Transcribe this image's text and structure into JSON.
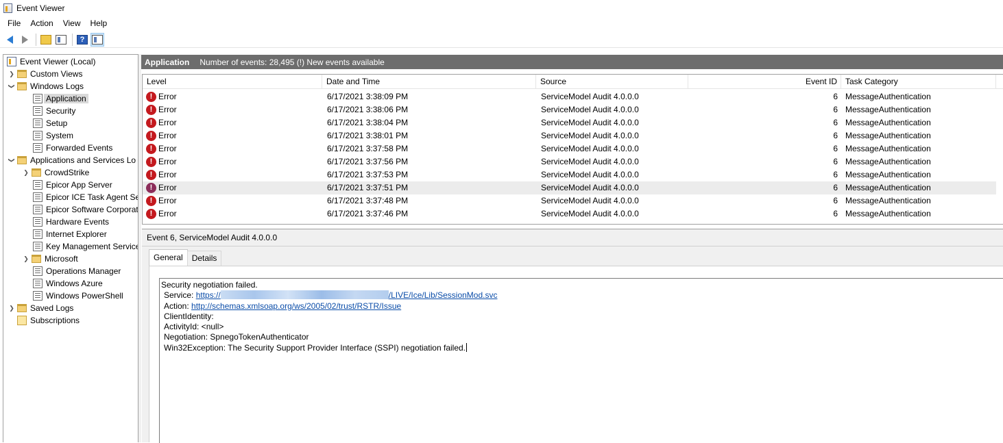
{
  "window": {
    "title": "Event Viewer"
  },
  "menu": [
    "File",
    "Action",
    "View",
    "Help"
  ],
  "toolbar": {
    "icons": [
      "back-arrow-icon",
      "forward-arrow-icon",
      "open-folder-icon",
      "show-hide-console-tree-icon",
      "help-icon",
      "show-hide-action-pane-icon"
    ],
    "help_glyph": "?"
  },
  "tree": {
    "root": "Event Viewer (Local)",
    "custom_views": "Custom Views",
    "windows_logs": "Windows Logs",
    "windows_logs_items": [
      "Application",
      "Security",
      "Setup",
      "System",
      "Forwarded Events"
    ],
    "apps_services": "Applications and Services Lo",
    "apps_services_items": [
      "CrowdStrike",
      "Epicor App Server",
      "Epicor ICE Task Agent Ser",
      "Epicor Software Corporat",
      "Hardware Events",
      "Internet Explorer",
      "Key Management Service",
      "Microsoft",
      "Operations Manager",
      "Windows Azure",
      "Windows PowerShell"
    ],
    "saved_logs": "Saved Logs",
    "subscriptions": "Subscriptions",
    "selected": "Application"
  },
  "log_header": {
    "name": "Application",
    "info": "Number of events: 28,495 (!) New events available"
  },
  "table": {
    "columns": [
      "Level",
      "Date and Time",
      "Source",
      "Event ID",
      "Task Category"
    ],
    "rows": [
      {
        "level": "Error",
        "date": "6/17/2021 3:38:09 PM",
        "source": "ServiceModel Audit 4.0.0.0",
        "event_id": "6",
        "category": "MessageAuthentication"
      },
      {
        "level": "Error",
        "date": "6/17/2021 3:38:06 PM",
        "source": "ServiceModel Audit 4.0.0.0",
        "event_id": "6",
        "category": "MessageAuthentication"
      },
      {
        "level": "Error",
        "date": "6/17/2021 3:38:04 PM",
        "source": "ServiceModel Audit 4.0.0.0",
        "event_id": "6",
        "category": "MessageAuthentication"
      },
      {
        "level": "Error",
        "date": "6/17/2021 3:38:01 PM",
        "source": "ServiceModel Audit 4.0.0.0",
        "event_id": "6",
        "category": "MessageAuthentication"
      },
      {
        "level": "Error",
        "date": "6/17/2021 3:37:58 PM",
        "source": "ServiceModel Audit 4.0.0.0",
        "event_id": "6",
        "category": "MessageAuthentication"
      },
      {
        "level": "Error",
        "date": "6/17/2021 3:37:56 PM",
        "source": "ServiceModel Audit 4.0.0.0",
        "event_id": "6",
        "category": "MessageAuthentication"
      },
      {
        "level": "Error",
        "date": "6/17/2021 3:37:53 PM",
        "source": "ServiceModel Audit 4.0.0.0",
        "event_id": "6",
        "category": "MessageAuthentication"
      },
      {
        "level": "Error",
        "date": "6/17/2021 3:37:51 PM",
        "source": "ServiceModel Audit 4.0.0.0",
        "event_id": "6",
        "category": "MessageAuthentication"
      },
      {
        "level": "Error",
        "date": "6/17/2021 3:37:48 PM",
        "source": "ServiceModel Audit 4.0.0.0",
        "event_id": "6",
        "category": "MessageAuthentication"
      },
      {
        "level": "Error",
        "date": "6/17/2021 3:37:46 PM",
        "source": "ServiceModel Audit 4.0.0.0",
        "event_id": "6",
        "category": "MessageAuthentication"
      }
    ],
    "highlighted_row": 7,
    "error_glyph": "!"
  },
  "details": {
    "header": "Event 6, ServiceModel Audit 4.0.0.0",
    "tabs": [
      "General",
      "Details"
    ],
    "active_tab": "General",
    "line1": "Security negotiation failed.",
    "service_label": "Service:",
    "service_link_start": "https://",
    "service_link_end": "/LIVE/Ice/Lib/SessionMod.svc",
    "action_label": "Action:",
    "action_link": "http://schemas.xmlsoap.org/ws/2005/02/trust/RSTR/Issue",
    "client_identity": "ClientIdentity:",
    "activity_id": "ActivityId: <null>",
    "negotiation": "Negotiation: SpnegoTokenAuthenticator",
    "win32": "Win32Exception: The Security Support Provider Interface (SSPI) negotiation failed."
  },
  "colors": {
    "header_bar": "#6d6d6d",
    "error_red": "#c4191e",
    "link": "#0a4ca8",
    "selection": "#d9d9d9"
  }
}
